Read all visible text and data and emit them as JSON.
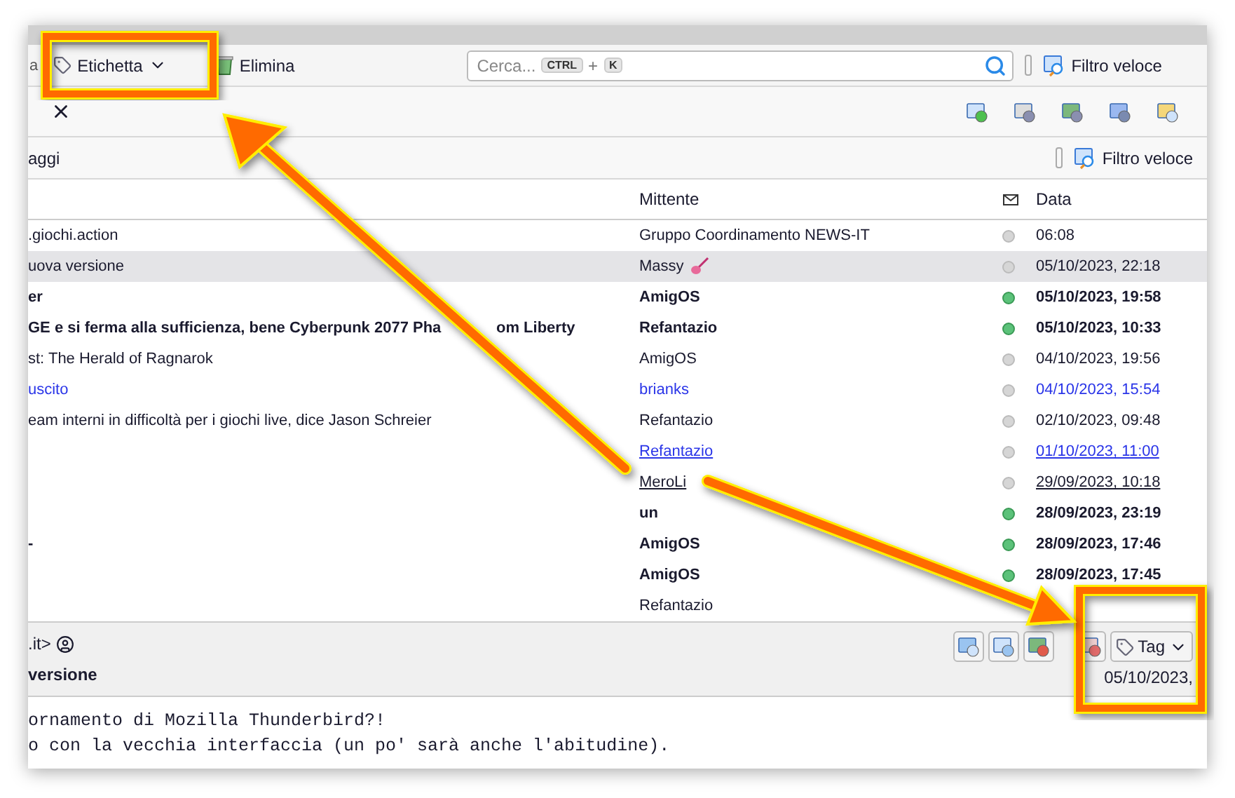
{
  "toolbar": {
    "cut_label": "a",
    "tag_button": "Etichetta",
    "delete_button": "Elimina",
    "search": {
      "placeholder": "Cerca...",
      "keys": [
        "CTRL",
        "K"
      ],
      "joiner": "+"
    },
    "quick_filter": "Filtro veloce"
  },
  "filter_bar": {
    "label": "aggi",
    "quick_filter": "Filtro veloce"
  },
  "table": {
    "columns": [
      "Mittente",
      "Data"
    ],
    "rows": [
      {
        "subject": ".giochi.action",
        "sender": "Gruppo Coordinamento NEWS-IT",
        "date": "06:08",
        "unread": false,
        "selected": false,
        "kind": "plain"
      },
      {
        "subject": "uova versione",
        "sender": "Massy",
        "date": "05/10/2023, 22:18",
        "unread": false,
        "selected": true,
        "kind": "plain"
      },
      {
        "subject": "er",
        "sender": "AmigOS",
        "date": "05/10/2023, 19:58",
        "unread": true,
        "selected": false,
        "kind": "plain"
      },
      {
        "subject": "GE e si ferma alla sufficienza, bene Cyberpunk 2077 Pha",
        "subject_tail": "om Liberty",
        "sender": "Refantazio",
        "date": "05/10/2023, 10:33",
        "unread": true,
        "selected": false,
        "kind": "plain"
      },
      {
        "subject": "st: The Herald of Ragnarok",
        "sender": "AmigOS",
        "date": "04/10/2023, 19:56",
        "unread": false,
        "selected": false,
        "kind": "plain"
      },
      {
        "subject": "uscito",
        "sender": "brianks",
        "date": "04/10/2023, 15:54",
        "unread": false,
        "selected": false,
        "kind": "blue"
      },
      {
        "subject": "eam interni in difficoltà per i giochi live, dice Jason Schreier",
        "sender": "Refantazio",
        "date": "02/10/2023, 09:48",
        "unread": false,
        "selected": false,
        "kind": "plain"
      },
      {
        "subject": "",
        "sender": "Refantazio",
        "date": "01/10/2023, 11:00",
        "unread": false,
        "selected": false,
        "kind": "link"
      },
      {
        "subject": "",
        "sender": "MeroLi",
        "date": "29/09/2023, 10:18",
        "unread": false,
        "selected": false,
        "kind": "underlined"
      },
      {
        "subject": "",
        "sender": "un",
        "date": "28/09/2023, 23:19",
        "unread": true,
        "selected": false,
        "kind": "plain"
      },
      {
        "subject": "-",
        "sender": "AmigOS",
        "date": "28/09/2023, 17:46",
        "unread": true,
        "selected": false,
        "kind": "plain"
      },
      {
        "subject": "",
        "sender": "AmigOS",
        "date": "28/09/2023, 17:45",
        "unread": true,
        "selected": false,
        "kind": "plain"
      },
      {
        "subject": "",
        "sender": "Refantazio",
        "selected": false,
        "kind": "plain"
      }
    ]
  },
  "message_header": {
    "from": ".it>",
    "subject": "versione",
    "tag_button": "Tag",
    "date": "05/10/2023,"
  },
  "body": {
    "lines": [
      "ornamento di Mozilla Thunderbird?!",
      "o con la vecchia interfaccia (un po' sarà anche l'abitudine)."
    ]
  }
}
